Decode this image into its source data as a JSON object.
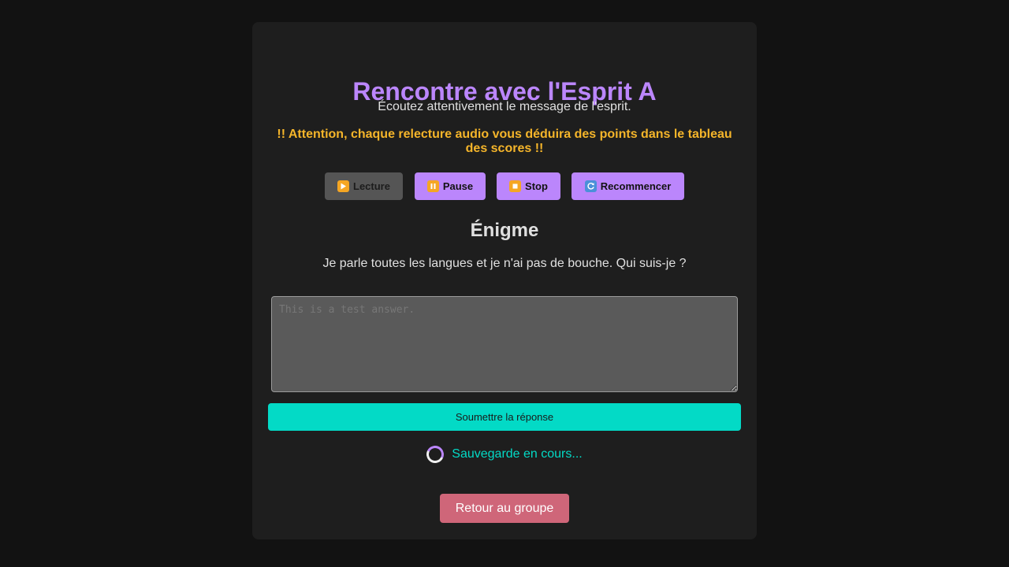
{
  "page": {
    "title": "Rencontre avec l'Esprit A",
    "instruction": "Écoutez attentivement le message de l'esprit.",
    "warning": "!! Attention, chaque relecture audio vous déduira des points dans le tableau des scores !!"
  },
  "audio_controls": [
    {
      "label": "Lecture",
      "icon": "play-icon",
      "enabled": false
    },
    {
      "label": "Pause",
      "icon": "pause-icon",
      "enabled": true
    },
    {
      "label": "Stop",
      "icon": "stop-icon",
      "enabled": true
    },
    {
      "label": "Recommencer",
      "icon": "restart-icon",
      "enabled": true
    }
  ],
  "riddle": {
    "heading": "Énigme",
    "question": "Je parle toutes les langues et je n'ai pas de bouche. Qui suis-je ?"
  },
  "answer": {
    "placeholder": "This is a test answer.",
    "value": ""
  },
  "submit_label": "Soumettre la réponse",
  "status": {
    "saving_text": "Sauvegarde en cours..."
  },
  "back_label": "Retour au groupe",
  "colors": {
    "background": "#121212",
    "card": "#1e1e1e",
    "accent_purple": "#bb86fc",
    "warning": "#f5b52a",
    "teal": "#03dac6",
    "back_button": "#cf6679",
    "disabled_button": "#555555"
  }
}
